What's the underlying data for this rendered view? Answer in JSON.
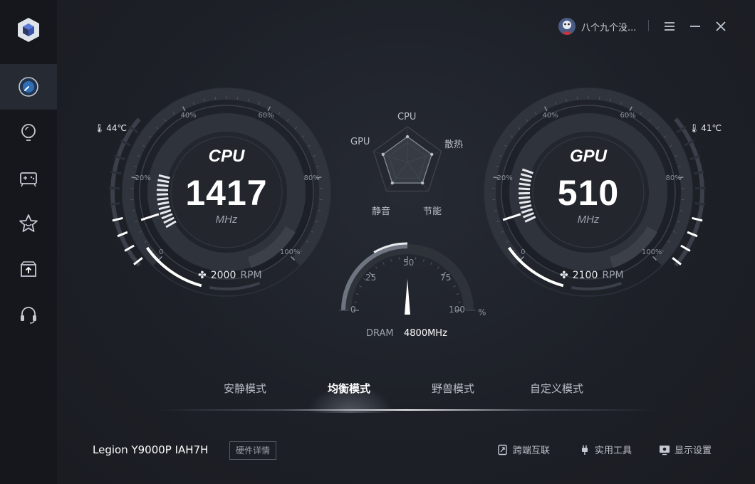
{
  "topbar": {
    "user_name": "八个九个没..."
  },
  "cpu": {
    "title": "CPU",
    "value": "1417",
    "unit": "MHz",
    "temperature": "44℃",
    "fan_speed": "2000",
    "fan_unit": "RPM",
    "load_fraction": 0.1,
    "temp_fraction": 0.35,
    "ticks": [
      "0",
      "20%",
      "40%",
      "60%",
      "80%",
      "100%"
    ]
  },
  "gpu": {
    "title": "GPU",
    "value": "510",
    "unit": "MHz",
    "temperature": "41℃",
    "fan_speed": "2100",
    "fan_unit": "RPM",
    "load_fraction": 0.1,
    "temp_fraction": 0.35,
    "ticks": [
      "0",
      "20%",
      "40%",
      "60%",
      "80%",
      "100%"
    ]
  },
  "radar": {
    "labels": {
      "cpu": "CPU",
      "cooling": "散热",
      "energy": "节能",
      "quiet": "静音",
      "gpu": "GPU"
    }
  },
  "dram": {
    "label": "DRAM",
    "frequency": "4800MHz",
    "usage_percent": 50,
    "ticks": [
      "0",
      "25",
      "50",
      "75",
      "100"
    ],
    "unit": "%"
  },
  "modes": {
    "items": [
      "安静模式",
      "均衡模式",
      "野兽模式",
      "自定义模式"
    ],
    "active": "均衡模式"
  },
  "footer": {
    "device_name": "Legion Y9000P IAH7H",
    "detail_button": "硬件详情",
    "links": [
      "跨端互联",
      "实用工具",
      "显示设置"
    ]
  },
  "colors": {
    "background": "#1c1f26",
    "sidebar": "#15171c",
    "accent": "#ffffff"
  }
}
